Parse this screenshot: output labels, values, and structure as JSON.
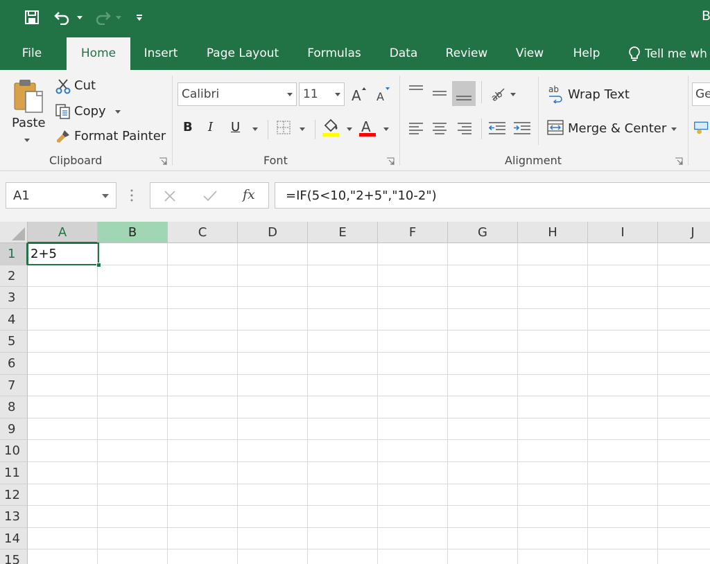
{
  "title_fragment": "B",
  "tabs": [
    {
      "label": "File",
      "active": false
    },
    {
      "label": "Home",
      "active": true
    },
    {
      "label": "Insert",
      "active": false
    },
    {
      "label": "Page Layout",
      "active": false
    },
    {
      "label": "Formulas",
      "active": false
    },
    {
      "label": "Data",
      "active": false
    },
    {
      "label": "Review",
      "active": false
    },
    {
      "label": "View",
      "active": false
    },
    {
      "label": "Help",
      "active": false
    }
  ],
  "tell_me": "Tell me wh",
  "clipboard": {
    "paste": "Paste",
    "cut": "Cut",
    "copy": "Copy",
    "format_painter": "Format Painter",
    "group_label": "Clipboard"
  },
  "font": {
    "name": "Calibri",
    "size": "11",
    "bold": "B",
    "italic": "I",
    "underline": "U",
    "color_letter": "A",
    "highlight_color": "#ffff00",
    "font_color": "#ff0000",
    "group_label": "Font"
  },
  "alignment": {
    "wrap_text": "Wrap Text",
    "merge_center": "Merge & Center",
    "group_label": "Alignment"
  },
  "number": {
    "format_fragment": "Ge"
  },
  "formula_bar": {
    "name_box": "A1",
    "formula": "=IF(5<10,\"2+5\",\"10-2\")",
    "fx": "fx"
  },
  "columns": [
    "A",
    "B",
    "C",
    "D",
    "E",
    "F",
    "G",
    "H",
    "I",
    "J"
  ],
  "rows": [
    "1",
    "2",
    "3",
    "4",
    "5",
    "6",
    "7",
    "8",
    "9",
    "10",
    "11",
    "12",
    "13",
    "14",
    "15"
  ],
  "cells": {
    "A1": "2+5"
  },
  "colors": {
    "brand": "#217346",
    "selected_column_b": "#a0d6b4"
  }
}
